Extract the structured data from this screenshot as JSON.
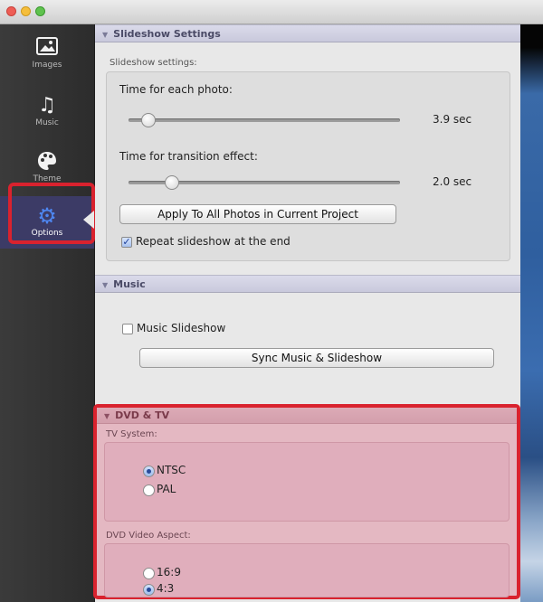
{
  "sidebar": {
    "items": [
      {
        "label": "Images",
        "icon": "image-icon"
      },
      {
        "label": "Music",
        "icon": "music-note-icon"
      },
      {
        "label": "Theme",
        "icon": "palette-icon"
      },
      {
        "label": "Options",
        "icon": "gear-icon",
        "active": true
      }
    ]
  },
  "slideshow": {
    "header": "Slideshow Settings",
    "group_label": "Slideshow settings:",
    "photo_time_label": "Time for each photo:",
    "photo_time_value": "3.9 sec",
    "photo_time_fraction": 0.05,
    "transition_label": "Time for transition effect:",
    "transition_value": "2.0 sec",
    "transition_fraction": 0.14,
    "apply_button": "Apply To All Photos in Current Project",
    "repeat_label": "Repeat slideshow at the end",
    "repeat_checked": true
  },
  "music": {
    "header": "Music",
    "music_slideshow_label": "Music Slideshow",
    "music_slideshow_checked": false,
    "sync_button": "Sync Music & Slideshow"
  },
  "dvd": {
    "header": "DVD & TV",
    "tv_system_label": "TV System:",
    "tv_options": [
      {
        "label": "NTSC",
        "selected": true
      },
      {
        "label": "PAL",
        "selected": false
      }
    ],
    "aspect_label": "DVD Video Aspect:",
    "aspect_options": [
      {
        "label": "16:9",
        "selected": false
      },
      {
        "label": "4:3",
        "selected": true
      }
    ]
  },
  "colors": {
    "highlight": "#d9222e",
    "sidebar_bg": "#2c2c2c",
    "active_icon": "#4e86f0"
  }
}
